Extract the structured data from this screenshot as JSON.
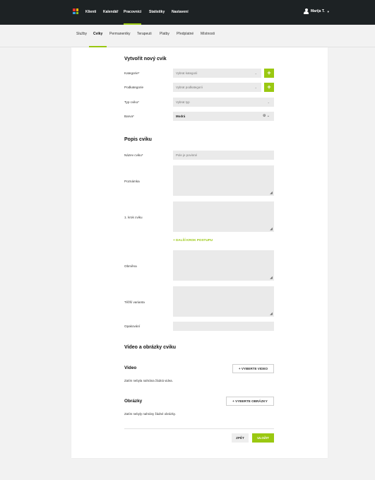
{
  "topnav": {
    "items": [
      "Klienti",
      "Kalendář",
      "Pracovníci",
      "Statistiky",
      "Nastavení"
    ],
    "user": "Marija T."
  },
  "subnav": {
    "items": [
      "Služby",
      "Cviky",
      "Permanentky",
      "Terapeuti",
      "Platby",
      "Předplatné",
      "Místnosti"
    ]
  },
  "form": {
    "title": "Vytvořit nový cvik",
    "category": {
      "label": "Kategorie*",
      "placeholder": "Vybrat kategorii"
    },
    "subcategory": {
      "label": "Podkategorie",
      "placeholder": "Vybrat podkategorii"
    },
    "type": {
      "label": "Typ cviku*",
      "placeholder": "Vybrat typ"
    },
    "color": {
      "label": "Barva*",
      "value": "Modrá"
    },
    "plus": "+",
    "description_title": "Popis cviku",
    "name": {
      "label": "Název cviku*",
      "placeholder": "Pole je povinné"
    },
    "note": {
      "label": "Poznámka"
    },
    "step1": {
      "label": "1. krok cviku"
    },
    "next_step": "+ DALŠÍ KROK POSTUPU",
    "variation": {
      "label": "Obměna"
    },
    "harder": {
      "label": "Těžší varianta"
    },
    "repeats": {
      "label": "Opakování"
    }
  },
  "media": {
    "title": "Video a obrázky cviku",
    "video_title": "Video",
    "video_button": "+ VYBERTE VIDEO",
    "video_empty": "Zatím nebyla nahrána žádná videa.",
    "images_title": "Obrázky",
    "images_button": "+ VYBERTE OBRÁZKY",
    "images_empty": "Zatím nebyly nahrány žádné obrázky."
  },
  "actions": {
    "back": "ZPĚT",
    "save": "ULOŽIT"
  },
  "colors": {
    "accent": "#9ac811",
    "topbar": "#1d2224"
  }
}
